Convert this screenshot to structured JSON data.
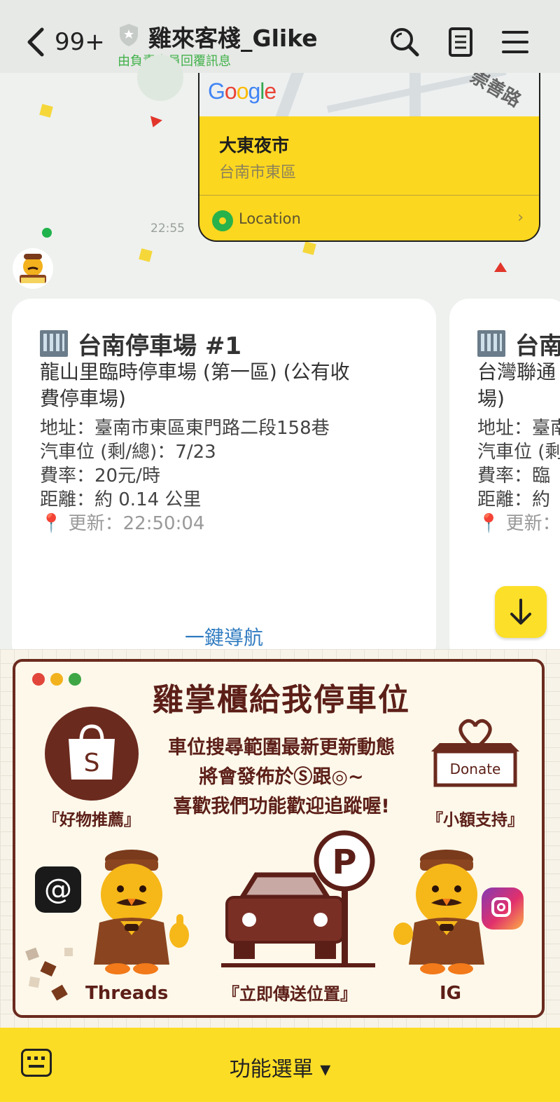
{
  "header": {
    "unread": "99+",
    "title": "雞來客棧_Glike",
    "subtitle": "由負責人員回覆訊息"
  },
  "location_message": {
    "map_brand": "Google",
    "road_label": "崇善路",
    "place_name": "大東夜市",
    "place_area": "台南市東區",
    "action_label": "Location",
    "time": "22:55"
  },
  "cards": [
    {
      "title": "台南停車場 #1",
      "name_lines": [
        "龍山里臨時停車場 (第一區) (公有收",
        "費停車場)"
      ],
      "address": "地址：臺南市東區東門路二段158巷",
      "spaces": "汽車位 (剩/總)：7/23",
      "rate": "費率：20元/時",
      "distance": "距離：約 0.14 公里",
      "updated": "更新：22:50:04",
      "nav_label": "一鍵導航"
    },
    {
      "title": "台南",
      "name_lines": [
        "台灣聯通",
        "場)"
      ],
      "address": "地址：臺南",
      "spaces": "汽車位 (剩",
      "rate": "費率：臨",
      "distance": "距離：約",
      "updated": "更新："
    }
  ],
  "rich_menu": {
    "title": "雞掌櫃給我停車位",
    "lines": [
      "車位搜尋範圍最新更新動態",
      "將會發佈於Ⓢ跟◎~",
      "喜歡我們功能歡迎追蹤喔!"
    ],
    "shop_caption": "『好物推薦』",
    "donate_label": "Donate",
    "donate_caption": "『小額支持』",
    "threads_caption": "Threads",
    "send_location_caption": "『立即傳送位置』",
    "ig_caption": "IG",
    "parking_letter": "P",
    "shop_letter": "S",
    "threads_glyph": "@"
  },
  "bottom_bar": {
    "menu_label": "功能選單 ▾"
  },
  "colors": {
    "header_bg": "#e6e9e6",
    "chat_bg": "#eef1ee",
    "location_card": "#fcd71f",
    "link": "#2f7bc0",
    "subtitle_green": "#42b14a",
    "rich_brown": "#5c1f18",
    "bottom_bar": "#fcdd25"
  }
}
